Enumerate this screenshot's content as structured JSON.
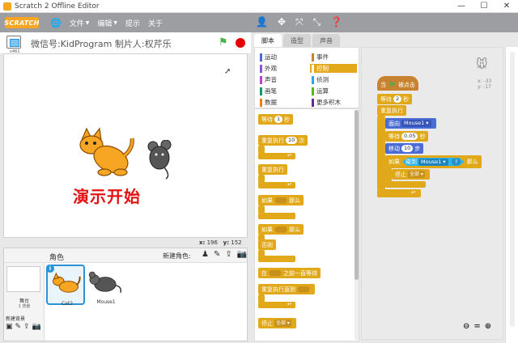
{
  "window": {
    "title": "Scratch 2 Offline Editor",
    "minimize": "—",
    "maximize": "☐",
    "close": "✕"
  },
  "menubar": {
    "logo": "SCRATCH",
    "globe": "🌐",
    "items": [
      {
        "label": "文件"
      },
      {
        "label": "编辑"
      },
      {
        "label": "提示"
      },
      {
        "label": "关于"
      }
    ],
    "tools": [
      "👤",
      "✥",
      "⤧",
      "⤡",
      "❓"
    ]
  },
  "stage": {
    "caption": "微信号:KidProgram 制片人:权芹乐",
    "version": "v461",
    "demo_text": "演示开始",
    "coords": {
      "x_label": "x:",
      "x_value": "196",
      "y_label": "y:",
      "y_value": "152"
    }
  },
  "sprites": {
    "title": "角色",
    "new_sprite_label": "新建角色:",
    "stage_label": "舞台",
    "stage_sub": "1 背景",
    "new_backdrop_label": "新建背景",
    "items": [
      {
        "name": "Cat2",
        "selected": true
      },
      {
        "name": "Mouse1",
        "selected": false
      }
    ]
  },
  "tabs": [
    {
      "label": "脚本",
      "active": true
    },
    {
      "label": "造型",
      "active": false
    },
    {
      "label": "声音",
      "active": false
    }
  ],
  "categories": [
    {
      "label": "运动",
      "color": "#4a6cd4"
    },
    {
      "label": "事件",
      "color": "#c88330"
    },
    {
      "label": "外观",
      "color": "#8a55d7"
    },
    {
      "label": "控制",
      "color": "#e1a91a"
    },
    {
      "label": "声音",
      "color": "#bb42c3"
    },
    {
      "label": "侦测",
      "color": "#2ca5e2"
    },
    {
      "label": "画笔",
      "color": "#0e9a6c"
    },
    {
      "label": "运算",
      "color": "#5cb712"
    },
    {
      "label": "数据",
      "color": "#ee7d16"
    },
    {
      "label": "更多积木",
      "color": "#632d99"
    }
  ],
  "palette": {
    "wait": "等待",
    "wait_val": "1",
    "wait_unit": "秒",
    "repeat": "重复执行",
    "repeat_val": "10",
    "repeat_unit": "次",
    "forever": "重复执行",
    "if_then": "如果",
    "then": "那么",
    "if_else": "如果",
    "else_then": "那么",
    "else": "否则",
    "wait_until": "在",
    "wait_until_suffix": "之前一直等待",
    "repeat_until": "重复执行直到",
    "stop": "停止",
    "stop_option": "全部 ▾"
  },
  "script": {
    "when_flag": "当",
    "when_flag_suffix": "被点击",
    "wait": "等待",
    "wait_val": "2",
    "wait_unit": "秒",
    "forever": "重复执行",
    "point_towards": "面向",
    "point_target": "Mouse1 ▾",
    "wait2": "等待",
    "wait2_val": "0.05",
    "wait2_unit": "秒",
    "move": "移动",
    "move_val": "10",
    "move_unit": "步",
    "if": "如果",
    "touching": "碰到",
    "touch_target": "Mouse1 ▾",
    "qmark": "?",
    "then": "那么",
    "stop": "停止",
    "stop_option": "全部 ▾",
    "readout_x": "x: -33",
    "readout_y": "y: -17"
  },
  "zoom": {
    "out": "⊖",
    "reset": "=",
    "in": "⊕"
  },
  "colors": {
    "control": "#e1a91a",
    "events": "#c88330",
    "motion": "#4a6cd4",
    "sensing": "#2ca5e2"
  }
}
